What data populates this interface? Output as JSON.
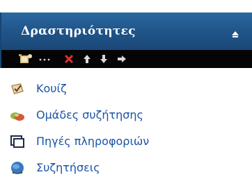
{
  "block": {
    "title": "Δραστηριότητες",
    "collapse_icon": "collapse-up-arrow-icon",
    "header_color": "#1f5387",
    "link_color": "#1a53a6"
  },
  "toolbar": {
    "icons": [
      "edit-mode-icon",
      "dots-icon",
      "delete-icon",
      "move-up-icon",
      "move-down-icon",
      "move-right-icon"
    ]
  },
  "activities": [
    {
      "label": "Κουίζ",
      "icon": "quiz-icon"
    },
    {
      "label": "Ομάδες συζήτησης",
      "icon": "forum-icon"
    },
    {
      "label": "Πηγές πληροφοριών",
      "icon": "resource-icon"
    },
    {
      "label": "Συζητήσεις",
      "icon": "chat-icon"
    }
  ]
}
